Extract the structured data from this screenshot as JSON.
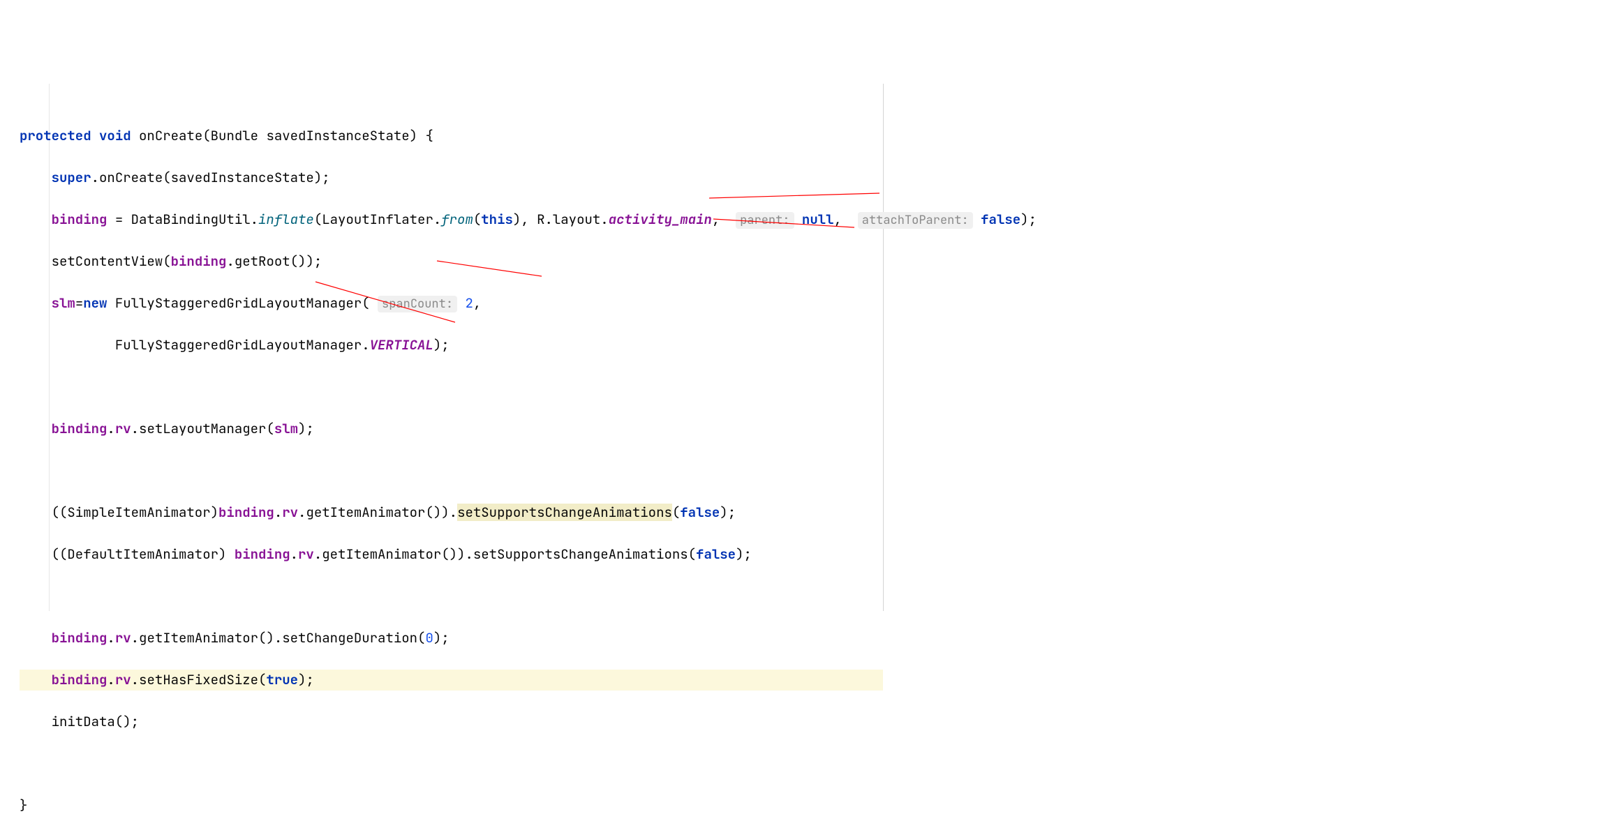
{
  "code": {
    "l1": {
      "kw1": "protected",
      "kw2": "void",
      "method": "onCreate",
      "paramType": "Bundle",
      "paramName": "savedInstanceState",
      "brace": ") {"
    },
    "l2": {
      "kw": "super",
      "rest": ".onCreate(savedInstanceState);"
    },
    "l3": {
      "f1": "binding",
      "eq": " = DataBindingUtil.",
      "mstatic": "inflate",
      "p1": "(LayoutInflater.",
      "mstatic2": "from",
      "p2": "(",
      "kw": "this",
      "p3": "), R.layout.",
      "fld": "activity_main",
      "comma": ", ",
      "hint1": "parent:",
      "sp1": " ",
      "kw2": "null",
      "comma2": ", ",
      "hint2": "attachToParent:",
      "sp2": " ",
      "kw3": "false",
      "end": ");"
    },
    "l4": {
      "t1": "setContentView(",
      "f": "binding",
      "t2": ".getRoot());"
    },
    "l5": {
      "f1": "slm",
      "t1": "=",
      "kw": "new",
      "t2": " FullyStaggeredGridLayoutManager( ",
      "hint": "spanCount:",
      "sp": " ",
      "num": "2",
      "t3": ","
    },
    "l6": {
      "t1": "FullyStaggeredGridLayoutManager.",
      "fld": "VERTICAL",
      "t2": ");"
    },
    "l8": {
      "f1": "binding",
      "t1": ".",
      "f2": "rv",
      "t2": ".setLayoutManager(",
      "f3": "slm",
      "t3": ");"
    },
    "l10": {
      "t1": "((SimpleItemAnimator)",
      "f1": "binding",
      "t2": ".",
      "f2": "rv",
      "t3": ".getItemAnimator()).",
      "marked": "setSupportsChangeAnimations",
      "t4": "(",
      "kw": "false",
      "t5": ");"
    },
    "l11": {
      "t1": "((DefaultItemAnimator) ",
      "f1": "binding",
      "t2": ".",
      "f2": "rv",
      "t3": ".getItemAnimator()).setSupportsChangeAnimations(",
      "kw": "false",
      "t4": ");"
    },
    "l13": {
      "f1": "binding",
      "t1": ".",
      "f2": "rv",
      "t2": ".getItemAnimator().setChangeDuration(",
      "num": "0",
      "t3": ");"
    },
    "l14": {
      "f1": "binding",
      "t1": ".",
      "f2": "rv",
      "t2": ".setHasFixedSize(",
      "kw": "true",
      "t3": ");"
    },
    "l15": {
      "t": "initData();"
    },
    "l17": {
      "t": "}"
    }
  }
}
